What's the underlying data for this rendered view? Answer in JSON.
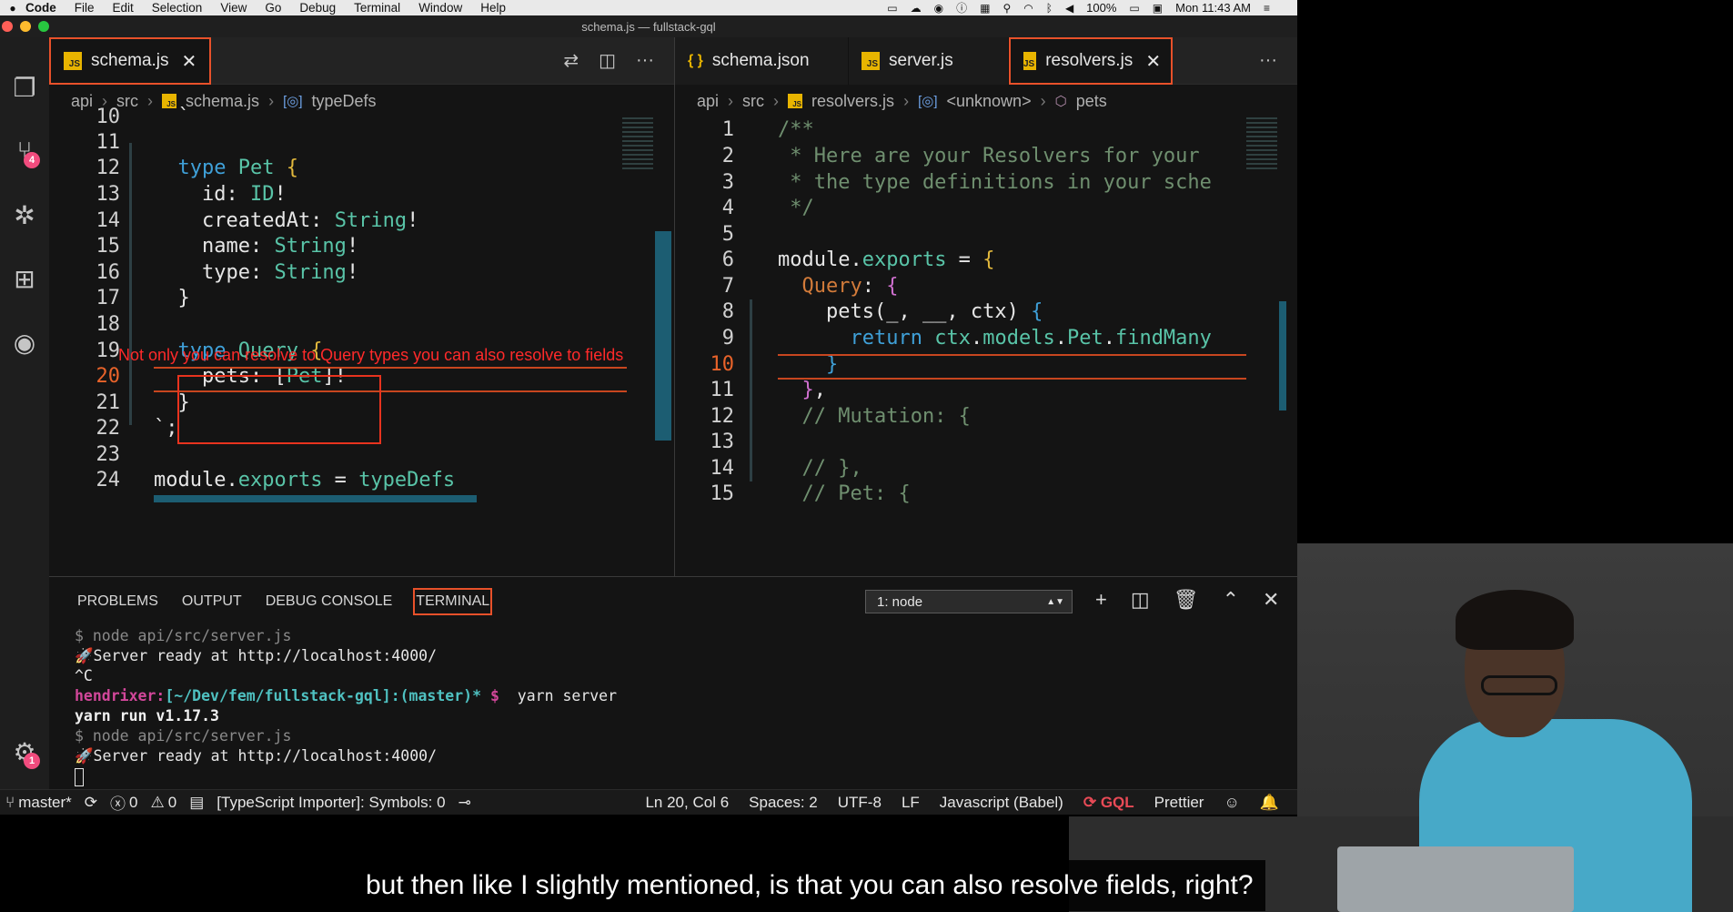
{
  "menubar": {
    "apple": "",
    "items": [
      "Code",
      "File",
      "Edit",
      "Selection",
      "View",
      "Go",
      "Debug",
      "Terminal",
      "Window",
      "Help"
    ],
    "battery": "100%",
    "clock": "Mon 11:43 AM"
  },
  "window": {
    "title": "schema.js — fullstack-gql"
  },
  "activity": {
    "scm_badge": "4",
    "settings_badge": "1"
  },
  "left_editor": {
    "tabs": [
      {
        "label": "schema.js",
        "icon": "JS",
        "active": true
      }
    ],
    "breadcrumb": [
      "api",
      "src",
      "schema.js",
      "typeDefs"
    ],
    "lines": [
      {
        "n": "10",
        "code": "  `"
      },
      {
        "n": "11",
        "code": ""
      },
      {
        "n": "12",
        "code": "  type Pet {"
      },
      {
        "n": "13",
        "code": "    id: ID!"
      },
      {
        "n": "14",
        "code": "    createdAt: String!"
      },
      {
        "n": "15",
        "code": "    name: String!"
      },
      {
        "n": "16",
        "code": "    type: String!"
      },
      {
        "n": "17",
        "code": "  }"
      },
      {
        "n": "18",
        "code": ""
      },
      {
        "n": "19",
        "code": "  type Query {"
      },
      {
        "n": "20",
        "code": "    pets: [Pet]!"
      },
      {
        "n": "21",
        "code": "  }"
      },
      {
        "n": "22",
        "code": "`;"
      },
      {
        "n": "23",
        "code": ""
      },
      {
        "n": "24",
        "code": "module.exports = typeDefs"
      }
    ],
    "annotation": "Not only you can resolve to Query types you can also resolve to fields"
  },
  "right_editor": {
    "tabs": [
      {
        "label": "schema.json",
        "icon": "{ }",
        "active": false
      },
      {
        "label": "server.js",
        "icon": "JS",
        "active": false
      },
      {
        "label": "resolvers.js",
        "icon": "JS",
        "active": true
      }
    ],
    "breadcrumb": [
      "api",
      "src",
      "resolvers.js",
      "<unknown>",
      "pets"
    ],
    "lines": [
      {
        "n": "1",
        "code": "/**"
      },
      {
        "n": "2",
        "code": " * Here are your Resolvers for your"
      },
      {
        "n": "3",
        "code": " * the type definitions in your sche"
      },
      {
        "n": "4",
        "code": " */"
      },
      {
        "n": "5",
        "code": ""
      },
      {
        "n": "6",
        "code": "module.exports = {"
      },
      {
        "n": "7",
        "code": "  Query: {"
      },
      {
        "n": "8",
        "code": "    pets(_, __, ctx) {"
      },
      {
        "n": "9",
        "code": "      return ctx.models.Pet.findMany"
      },
      {
        "n": "10",
        "code": "    }"
      },
      {
        "n": "11",
        "code": "  },"
      },
      {
        "n": "12",
        "code": "  // Mutation: {"
      },
      {
        "n": "13",
        "code": ""
      },
      {
        "n": "14",
        "code": "  // },"
      },
      {
        "n": "15",
        "code": "  // Pet: {"
      }
    ]
  },
  "panel": {
    "tabs": [
      "PROBLEMS",
      "OUTPUT",
      "DEBUG CONSOLE",
      "TERMINAL"
    ],
    "active_tab": "TERMINAL",
    "terminal_select": "1: node",
    "terminal": {
      "l1": "$ node api/src/server.js",
      "l2": "🚀Server ready at http://localhost:4000/",
      "l3": "^C",
      "prompt_user": "hendrixer:",
      "prompt_path": "[~/Dev/fem/fullstack-gql]:(master)*",
      "prompt_sign": " $  ",
      "prompt_cmd": "yarn server",
      "l5": "yarn run v1.17.3",
      "l6": "$ node api/src/server.js",
      "l7": "🚀Server ready at http://localhost:4000/"
    }
  },
  "statusbar": {
    "branch": "master*",
    "errors": "0",
    "warnings": "0",
    "importer": "[TypeScript Importer]: Symbols: 0",
    "position": "Ln 20, Col 6",
    "spaces": "Spaces: 2",
    "encoding": "UTF-8",
    "eol": "LF",
    "language": "Javascript (Babel)",
    "gql": "GQL",
    "prettier": "Prettier"
  },
  "caption": "but then like I slightly mentioned, is that you can also resolve fields, right?",
  "colors": {
    "accent": "#e8512a",
    "annotation": "#ff2a2a",
    "keyword": "#3fa0d8",
    "type": "#59c4a8"
  }
}
